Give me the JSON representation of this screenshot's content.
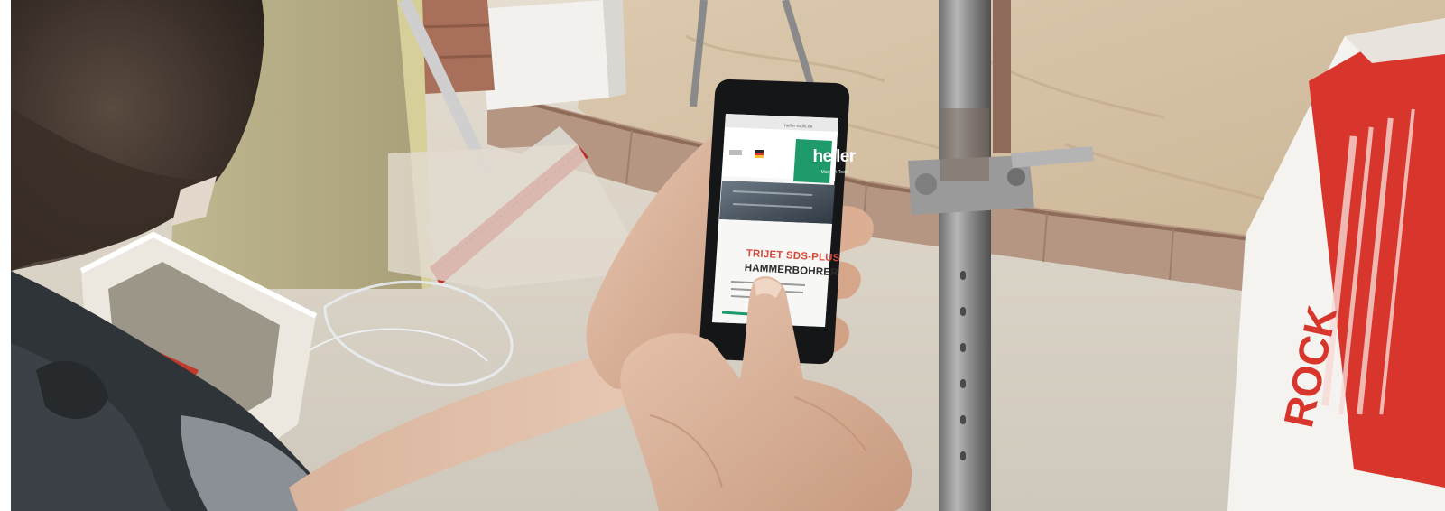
{
  "image": {
    "alt": "Person on a construction site holding a smartphone showing a product web page"
  },
  "phone_screen": {
    "url": "heller-tools.de",
    "brand": "heller",
    "brand_tagline": "Made in Tools",
    "headline_line1": "TRIJET SDS-PLUS",
    "headline_line2": "HAMMERBOHRER"
  },
  "box_lettering": "ROCK",
  "colors": {
    "brand_green": "#1f9a6a",
    "headline_red": "#d64a3c",
    "box_red": "#d8362c",
    "broom_red": "#b8302e"
  }
}
